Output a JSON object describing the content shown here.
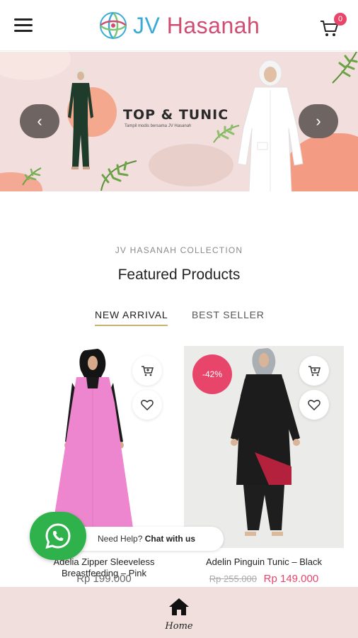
{
  "header": {
    "logo_jv": "JV",
    "logo_name": "Hasanah",
    "cart_count": "0",
    "menu_icon": "hamburger-menu-icon",
    "cart_icon": "shopping-cart-icon"
  },
  "banner": {
    "title": "TOP & TUNIC",
    "subtitle": "Tampil modis bersama JV Hasanah",
    "prev_label": "‹",
    "next_label": "›"
  },
  "section": {
    "kicker": "JV HASANAH COLLECTION",
    "title": "Featured Products",
    "tabs": [
      {
        "label": "NEW ARRIVAL",
        "active": true
      },
      {
        "label": "BEST SELLER",
        "active": false
      }
    ]
  },
  "products": [
    {
      "name": "Adelia Zipper Sleeveless Breastfeeding – Pink",
      "price": "Rp 199.000",
      "dress_color": "#ee86cf"
    },
    {
      "name": "Adelin Pinguin Tunic – Black",
      "old_price": "Rp 255.000",
      "price": "Rp 149.000",
      "discount": "-42%",
      "tunic_color": "#1c1c1c",
      "accent_color": "#b3213d"
    }
  ],
  "help": {
    "text": "Need Help?",
    "bold": "Chat with us",
    "icon": "whatsapp-icon"
  },
  "bottom_nav": {
    "home_label": "Home",
    "home_icon": "home-icon"
  },
  "colors": {
    "brand_pink": "#e8456b",
    "brand_blue": "#3aaad6",
    "tab_underline": "#c8b26e",
    "banner_bg": "#f1dedd",
    "whatsapp_green": "#2fb24c"
  }
}
